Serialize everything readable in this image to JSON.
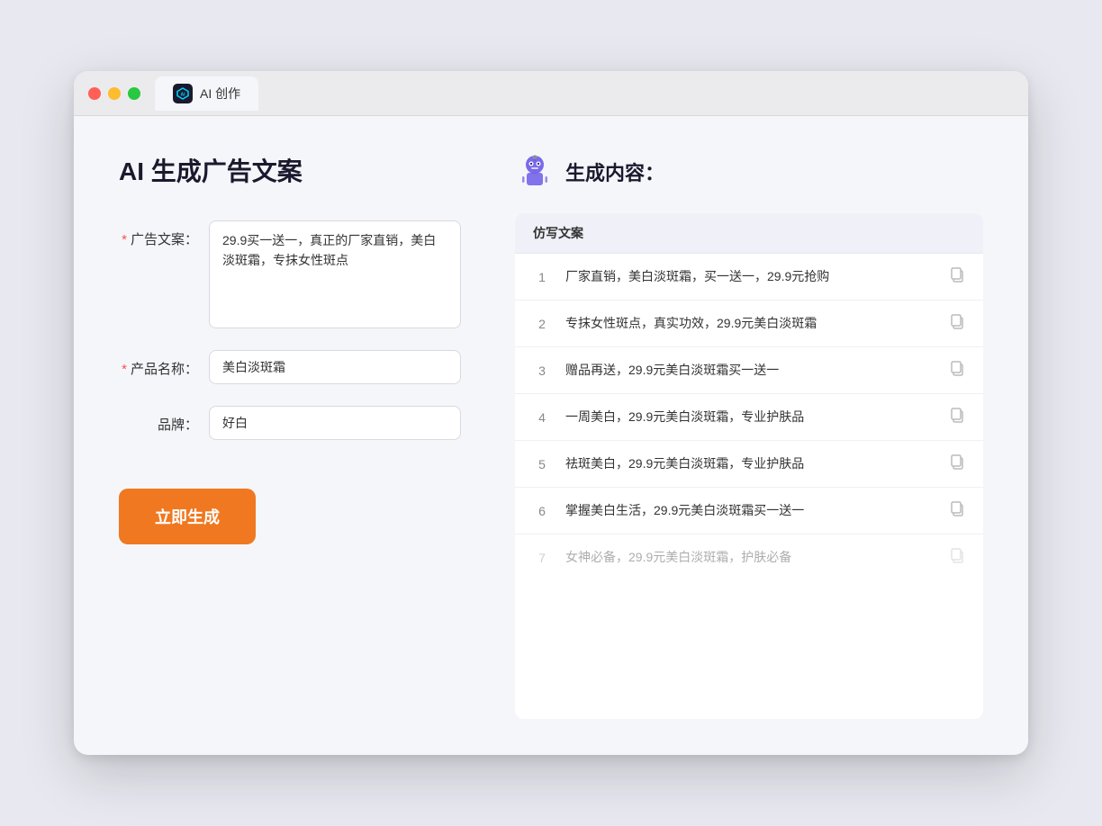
{
  "browser": {
    "tab_label": "AI 创作",
    "tab_icon_text": "AI"
  },
  "left": {
    "page_title": "AI 生成广告文案",
    "form": {
      "ad_copy_label": "广告文案：",
      "ad_copy_required": "*",
      "ad_copy_value": "29.9买一送一，真正的厂家直销，美白淡斑霜，专抹女性斑点",
      "product_name_label": "产品名称：",
      "product_name_required": "*",
      "product_name_value": "美白淡斑霜",
      "brand_label": "品牌：",
      "brand_value": "好白",
      "generate_btn": "立即生成"
    }
  },
  "right": {
    "header_title": "生成内容：",
    "table_col_header": "仿写文案",
    "rows": [
      {
        "num": "1",
        "text": "厂家直销，美白淡斑霜，买一送一，29.9元抢购",
        "faded": false
      },
      {
        "num": "2",
        "text": "专抹女性斑点，真实功效，29.9元美白淡斑霜",
        "faded": false
      },
      {
        "num": "3",
        "text": "赠品再送，29.9元美白淡斑霜买一送一",
        "faded": false
      },
      {
        "num": "4",
        "text": "一周美白，29.9元美白淡斑霜，专业护肤品",
        "faded": false
      },
      {
        "num": "5",
        "text": "祛斑美白，29.9元美白淡斑霜，专业护肤品",
        "faded": false
      },
      {
        "num": "6",
        "text": "掌握美白生活，29.9元美白淡斑霜买一送一",
        "faded": false
      },
      {
        "num": "7",
        "text": "女神必备，29.9元美白淡斑霜，护肤必备",
        "faded": true
      }
    ]
  }
}
